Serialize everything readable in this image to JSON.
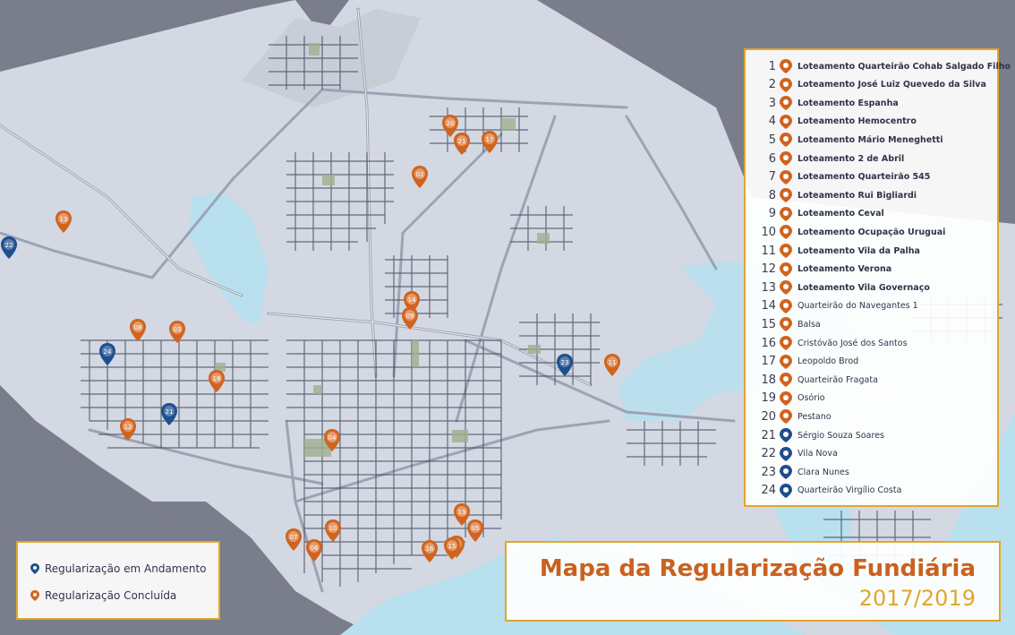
{
  "colors": {
    "concluded": "#d0641f",
    "in_progress": "#1e4f8c",
    "frame": "#e2a62b",
    "land": "#d3d8e3",
    "water": "#b9e0ee",
    "sea": "#7a7d8c"
  },
  "legend": {
    "items": [
      {
        "number": "1",
        "label": "Loteamento Quarteirão Cohab Salgado Filho",
        "status": "concluded",
        "bold": true
      },
      {
        "number": "2",
        "label": "Loteamento José Luiz Quevedo da Silva",
        "status": "concluded",
        "bold": true
      },
      {
        "number": "3",
        "label": "Loteamento Espanha",
        "status": "concluded",
        "bold": true
      },
      {
        "number": "4",
        "label": "Loteamento Hemocentro",
        "status": "concluded",
        "bold": true
      },
      {
        "number": "5",
        "label": "Loteamento Mário Meneghetti",
        "status": "concluded",
        "bold": true
      },
      {
        "number": "6",
        "label": "Loteamento 2 de Abril",
        "status": "concluded",
        "bold": true
      },
      {
        "number": "7",
        "label": "Loteamento Quarteirão 545",
        "status": "concluded",
        "bold": true
      },
      {
        "number": "8",
        "label": "Loteamento Rui Bigliardi",
        "status": "concluded",
        "bold": true
      },
      {
        "number": "9",
        "label": "Loteamento Ceval",
        "status": "concluded",
        "bold": true
      },
      {
        "number": "10",
        "label": "Loteamento Ocupação Uruguai",
        "status": "concluded",
        "bold": true
      },
      {
        "number": "11",
        "label": "Loteamento Vila da Palha",
        "status": "concluded",
        "bold": true
      },
      {
        "number": "12",
        "label": "Loteamento Verona",
        "status": "concluded",
        "bold": true
      },
      {
        "number": "13",
        "label": "Loteamento Vila Governaço",
        "status": "concluded",
        "bold": true
      },
      {
        "number": "14",
        "label": "Quarteirão do Navegantes 1",
        "status": "concluded",
        "bold": false
      },
      {
        "number": "15",
        "label": "Balsa",
        "status": "concluded",
        "bold": false
      },
      {
        "number": "16",
        "label": "Cristóvão José dos Santos",
        "status": "concluded",
        "bold": false
      },
      {
        "number": "17",
        "label": "Leopoldo Brod",
        "status": "concluded",
        "bold": false
      },
      {
        "number": "18",
        "label": "Quarteirão Fragata",
        "status": "concluded",
        "bold": false
      },
      {
        "number": "19",
        "label": "Osório",
        "status": "concluded",
        "bold": false
      },
      {
        "number": "20",
        "label": "Pestano",
        "status": "concluded",
        "bold": false
      },
      {
        "number": "21",
        "label": "Sérgio Souza Soares",
        "status": "in_progress",
        "bold": false
      },
      {
        "number": "22",
        "label": "Vila Nova",
        "status": "in_progress",
        "bold": false
      },
      {
        "number": "23",
        "label": "Clara Nunes",
        "status": "in_progress",
        "bold": false
      },
      {
        "number": "24",
        "label": "Quarteirão Virgílio Costa",
        "status": "in_progress",
        "bold": false
      }
    ]
  },
  "status_legend": {
    "in_progress_label": "Regularização em Andamento",
    "concluded_label": "Regularização Concluída"
  },
  "title": {
    "main": "Mapa da Regularização Fundiária",
    "period": "2017/2019"
  },
  "markers": [
    {
      "number": "20",
      "status": "concluded"
    },
    {
      "number": "21",
      "status": "concluded"
    },
    {
      "number": "17",
      "status": "concluded"
    },
    {
      "number": "02",
      "status": "concluded"
    },
    {
      "number": "13",
      "status": "concluded"
    },
    {
      "number": "22",
      "status": "in_progress"
    },
    {
      "number": "14",
      "status": "concluded"
    },
    {
      "number": "09",
      "status": "concluded"
    },
    {
      "number": "08",
      "status": "concluded"
    },
    {
      "number": "03",
      "status": "concluded"
    },
    {
      "number": "24",
      "status": "in_progress"
    },
    {
      "number": "18",
      "status": "concluded"
    },
    {
      "number": "21",
      "status": "in_progress"
    },
    {
      "number": "12",
      "status": "concluded"
    },
    {
      "number": "04",
      "status": "concluded"
    },
    {
      "number": "23",
      "status": "in_progress"
    },
    {
      "number": "11",
      "status": "concluded"
    },
    {
      "number": "10",
      "status": "concluded"
    },
    {
      "number": "07",
      "status": "concluded"
    },
    {
      "number": "06",
      "status": "concluded"
    },
    {
      "number": "16",
      "status": "concluded"
    },
    {
      "number": "19",
      "status": "concluded"
    },
    {
      "number": "05",
      "status": "concluded"
    },
    {
      "number": "01",
      "status": "concluded"
    },
    {
      "number": "15",
      "status": "concluded"
    }
  ]
}
